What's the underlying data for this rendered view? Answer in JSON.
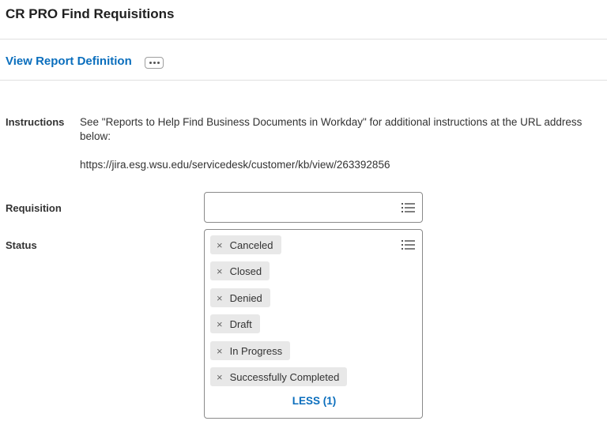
{
  "page": {
    "title": "CR PRO Find Requisitions",
    "view_report_link": "View Report Definition"
  },
  "form": {
    "instructions_label": "Instructions",
    "instructions_text": "See \"Reports to Help Find Business Documents in Workday\" for additional instructions at the URL address below:",
    "instructions_url": "https://jira.esg.wsu.edu/servicedesk/customer/kb/view/263392856",
    "requisition_label": "Requisition",
    "requisition_value": "",
    "status_label": "Status",
    "status_items": [
      "Canceled",
      "Closed",
      "Denied",
      "Draft",
      "In Progress",
      "Successfully Completed"
    ],
    "remove_glyph": "×",
    "less_link": "LESS (1)"
  },
  "icons": {
    "more": "ellipsis-icon",
    "list": "list-prompt-icon",
    "remove": "remove-x-icon"
  },
  "colors": {
    "link": "#0a6ebd",
    "pill_bg": "#e8e8e8",
    "border": "#8a8a8a"
  }
}
